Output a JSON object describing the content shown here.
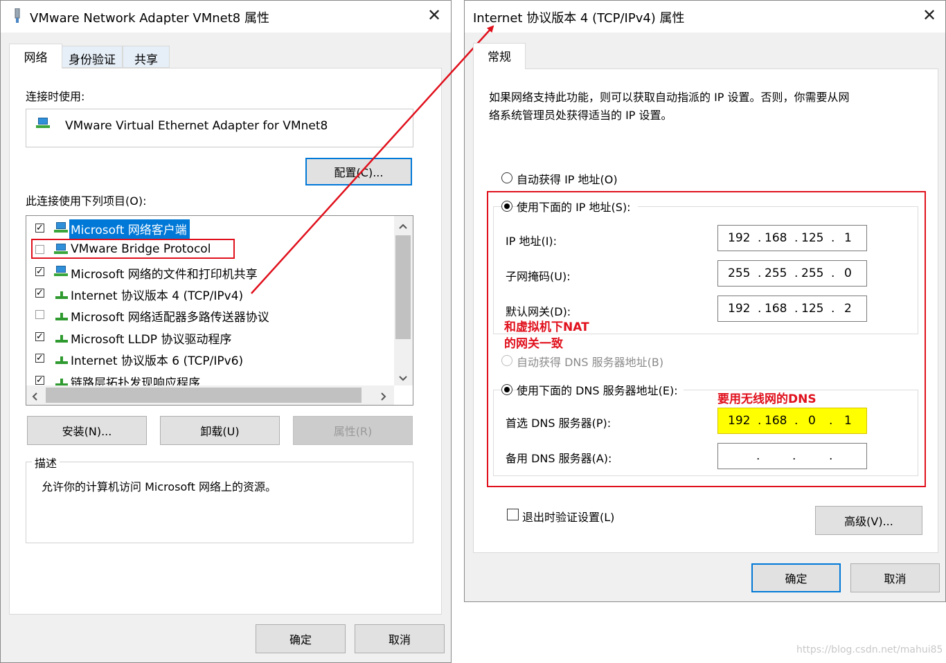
{
  "left_dialog": {
    "title": "VMware Network Adapter VMnet8 属性",
    "close_glyph": "✕",
    "tabs": [
      {
        "label": "网络"
      },
      {
        "label": "身份验证"
      },
      {
        "label": "共享"
      }
    ],
    "connect_using_label": "连接时使用:",
    "adapter_name": "VMware Virtual Ethernet Adapter for VMnet8",
    "configure_button": "配置(C)...",
    "items_label": "此连接使用下列项目(O):",
    "items": [
      {
        "label": "Microsoft 网络客户端",
        "checked": true,
        "icon": "network-client-icon"
      },
      {
        "label": "VMware Bridge Protocol",
        "checked": false,
        "icon": "network-client-icon"
      },
      {
        "label": "Microsoft 网络的文件和打印机共享",
        "checked": true,
        "icon": "network-client-icon"
      },
      {
        "label": "Internet 协议版本 4 (TCP/IPv4)",
        "checked": true,
        "icon": "protocol-icon"
      },
      {
        "label": "Microsoft 网络适配器多路传送器协议",
        "checked": false,
        "icon": "protocol-icon"
      },
      {
        "label": "Microsoft LLDP 协议驱动程序",
        "checked": true,
        "icon": "protocol-icon"
      },
      {
        "label": "Internet 协议版本 6 (TCP/IPv6)",
        "checked": true,
        "icon": "protocol-icon"
      },
      {
        "label": "链路层拓扑发现响应程序",
        "checked": true,
        "icon": "protocol-icon"
      }
    ],
    "install_button": "安装(N)...",
    "uninstall_button": "卸载(U)",
    "properties_button": "属性(R)",
    "description_label": "描述",
    "description_text": "允许你的计算机访问 Microsoft 网络上的资源。",
    "ok_button": "确定",
    "cancel_button": "取消"
  },
  "right_dialog": {
    "title": "Internet 协议版本 4 (TCP/IPv4) 属性",
    "close_glyph": "✕",
    "tab": "常规",
    "intro_line1": "如果网络支持此功能，则可以获取自动指派的 IP 设置。否则，你需要从网",
    "intro_line2": "络系统管理员处获得适当的 IP 设置。",
    "auto_ip_label": "自动获得 IP 地址(O)",
    "manual_ip_label": "使用下面的 IP 地址(S):",
    "ip_label": "IP 地址(I):",
    "ip_value": [
      "192",
      "168",
      "125",
      "1"
    ],
    "subnet_label": "子网掩码(U):",
    "subnet_value": [
      "255",
      "255",
      "255",
      "0"
    ],
    "gateway_label": "默认网关(D):",
    "gateway_value": [
      "192",
      "168",
      "125",
      "2"
    ],
    "auto_dns_label": "自动获得 DNS 服务器地址(B)",
    "manual_dns_label": "使用下面的 DNS 服务器地址(E):",
    "preferred_dns_label": "首选 DNS 服务器(P):",
    "preferred_dns_value": [
      "192",
      "168",
      "0",
      "1"
    ],
    "alternate_dns_label": "备用 DNS 服务器(A):",
    "alternate_dns_value": [
      "",
      "",
      "",
      ""
    ],
    "validate_label": "退出时验证设置(L)",
    "advanced_button": "高级(V)...",
    "ok_button": "确定",
    "cancel_button": "取消"
  },
  "annotations": {
    "gateway_note_line1": "和虚拟机下NAT",
    "gateway_note_line2": "的网关一致",
    "dns_note": "要用无线网的DNS"
  },
  "colors": {
    "annotation_red": "#e0101c",
    "highlight_yellow": "#ffff00",
    "selection_blue": "#0078d7"
  },
  "watermark": "https://blog.csdn.net/mahui85"
}
